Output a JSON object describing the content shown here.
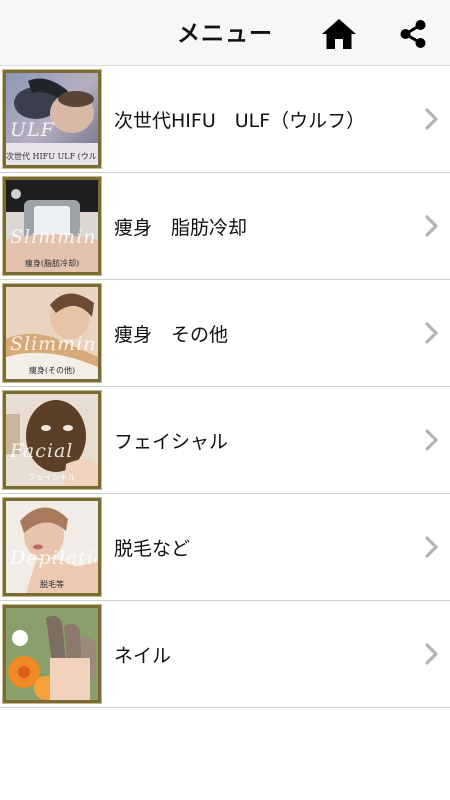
{
  "header": {
    "title": "メニュー",
    "home_icon": "home-icon",
    "share_icon": "share-icon"
  },
  "menu": [
    {
      "label": "次世代HIFU　ULF（ウルフ）",
      "thumb_script": "ULF",
      "thumb_caption": "次世代 HIFU ULF (ウルフ)",
      "image_subject": "hifu-treatment-photo"
    },
    {
      "label": "痩身　脂肪冷却",
      "thumb_script": "Slimming",
      "thumb_caption": "痩身(脂肪冷却)",
      "image_subject": "fat-cooling-device-photo"
    },
    {
      "label": "痩身　その他",
      "thumb_script": "Slimming",
      "thumb_caption": "痩身(その他)",
      "image_subject": "body-treatment-photo"
    },
    {
      "label": "フェイシャル",
      "thumb_script": "Facial",
      "thumb_caption": "フェイシャル",
      "image_subject": "facial-mask-photo"
    },
    {
      "label": "脱毛など",
      "thumb_script": "Depilation",
      "thumb_caption": "脱毛等",
      "image_subject": "depilation-model-photo"
    },
    {
      "label": "ネイル",
      "thumb_script": "",
      "thumb_caption": "",
      "image_subject": "nail-art-photo"
    }
  ],
  "colors": {
    "header_bg": "#f7f7f7",
    "divider": "#cfcfcf",
    "thumb_border": "#7a6a35",
    "chevron": "#b3b3b3",
    "text": "#111111"
  }
}
